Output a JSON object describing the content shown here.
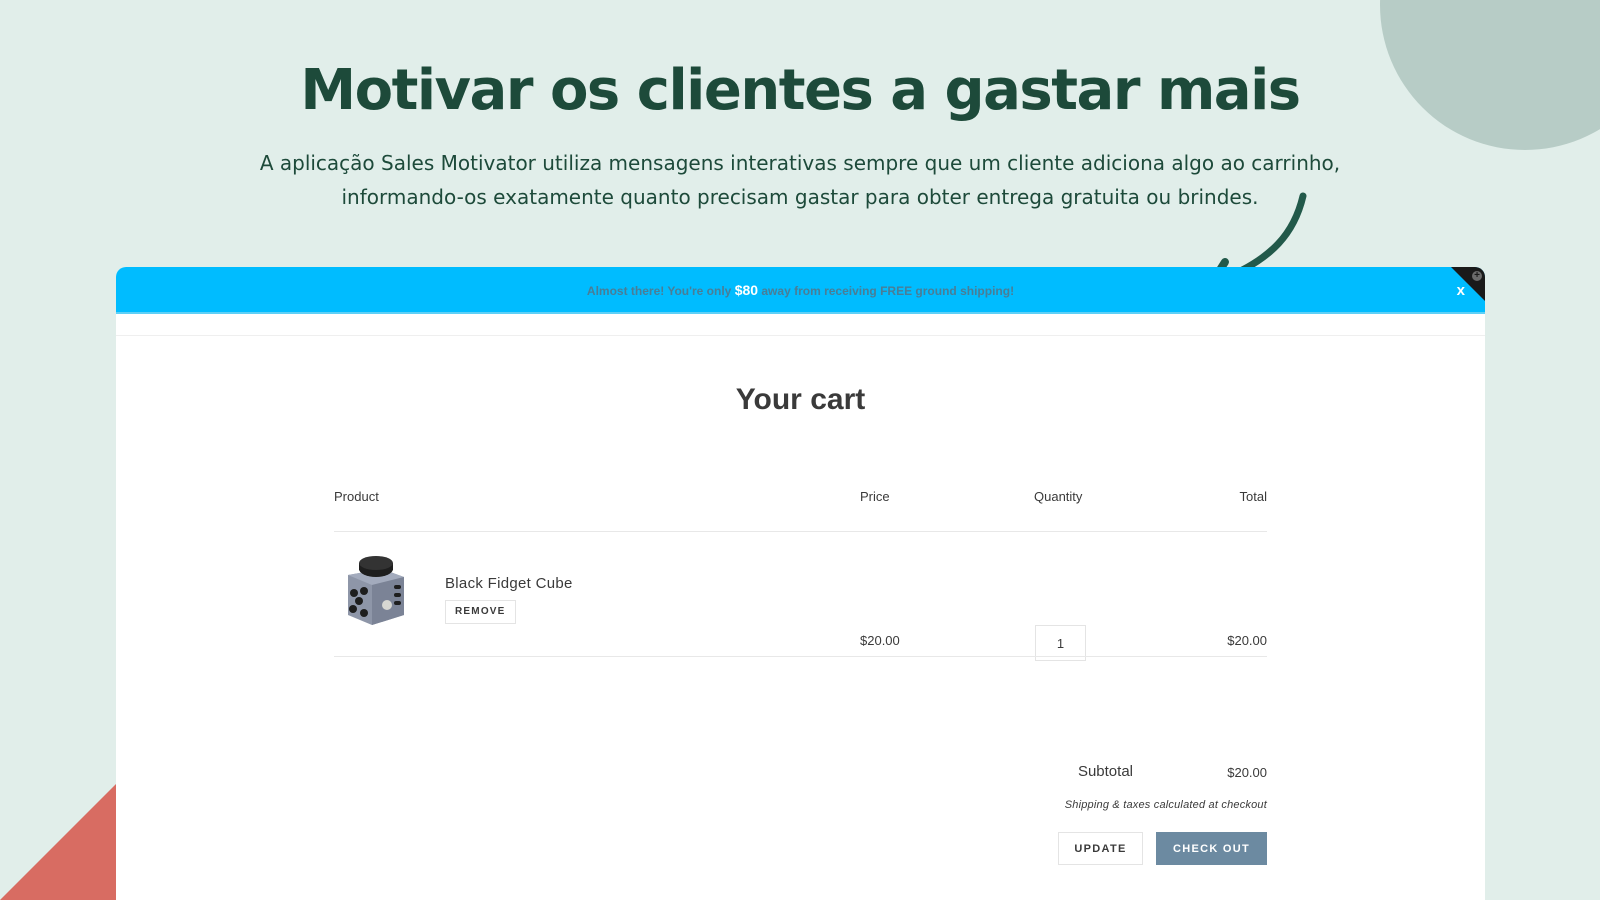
{
  "hero": {
    "headline": "Motivar os clientes a gastar mais",
    "subtext_line1": "A aplicação Sales Motivator utiliza mensagens interativas sempre que um cliente adiciona algo ao carrinho,",
    "subtext_line2": "informando-os exatamente quanto precisam gastar para obter entrega gratuita ou brindes."
  },
  "promo_bar": {
    "text_before": "Almost there! You're only ",
    "amount": "$80",
    "text_after": " away from receiving FREE ground shipping!",
    "close_label": "x",
    "corner_icon": "plus-circle-icon",
    "background_color": "#00bcff"
  },
  "cart": {
    "title": "Your cart",
    "columns": {
      "product": "Product",
      "price": "Price",
      "quantity": "Quantity",
      "total": "Total"
    },
    "items": [
      {
        "name": "Black Fidget Cube",
        "image_icon": "fidget-cube-image",
        "remove_label": "REMOVE",
        "price": "$20.00",
        "quantity": "1",
        "total": "$20.00"
      }
    ],
    "subtotal_label": "Subtotal",
    "subtotal_value": "$20.00",
    "shipping_note": "Shipping & taxes calculated at checkout",
    "update_label": "UPDATE",
    "checkout_label": "CHECK OUT",
    "checkout_color": "#6c8aa1"
  },
  "decor": {
    "headline_color": "#1d4a3a",
    "circle_color": "#b7ccc6",
    "triangle_color": "#d86c62",
    "arrow_color": "#22594a"
  }
}
